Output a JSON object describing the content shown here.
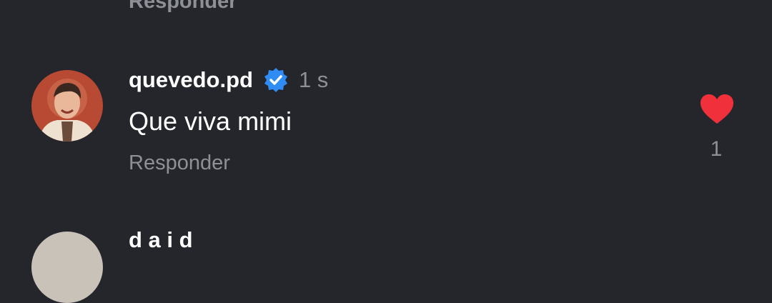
{
  "previous_comment": {
    "reply_label": "Responder"
  },
  "comment": {
    "avatar_icon": "profile-photo",
    "username": "quevedo.pd",
    "verified_icon": "verified-badge-icon",
    "timestamp": "1 s",
    "text": "Que viva mimi",
    "reply_label": "Responder",
    "like_icon": "heart-filled-icon",
    "like_count": "1"
  },
  "next_comment": {
    "username_partial": "d a i d"
  },
  "colors": {
    "background": "#25262b",
    "primary_text": "#ffffff",
    "secondary_text": "#8e9097",
    "verified_blue": "#2f8cf5",
    "like_red": "#f0303a"
  }
}
